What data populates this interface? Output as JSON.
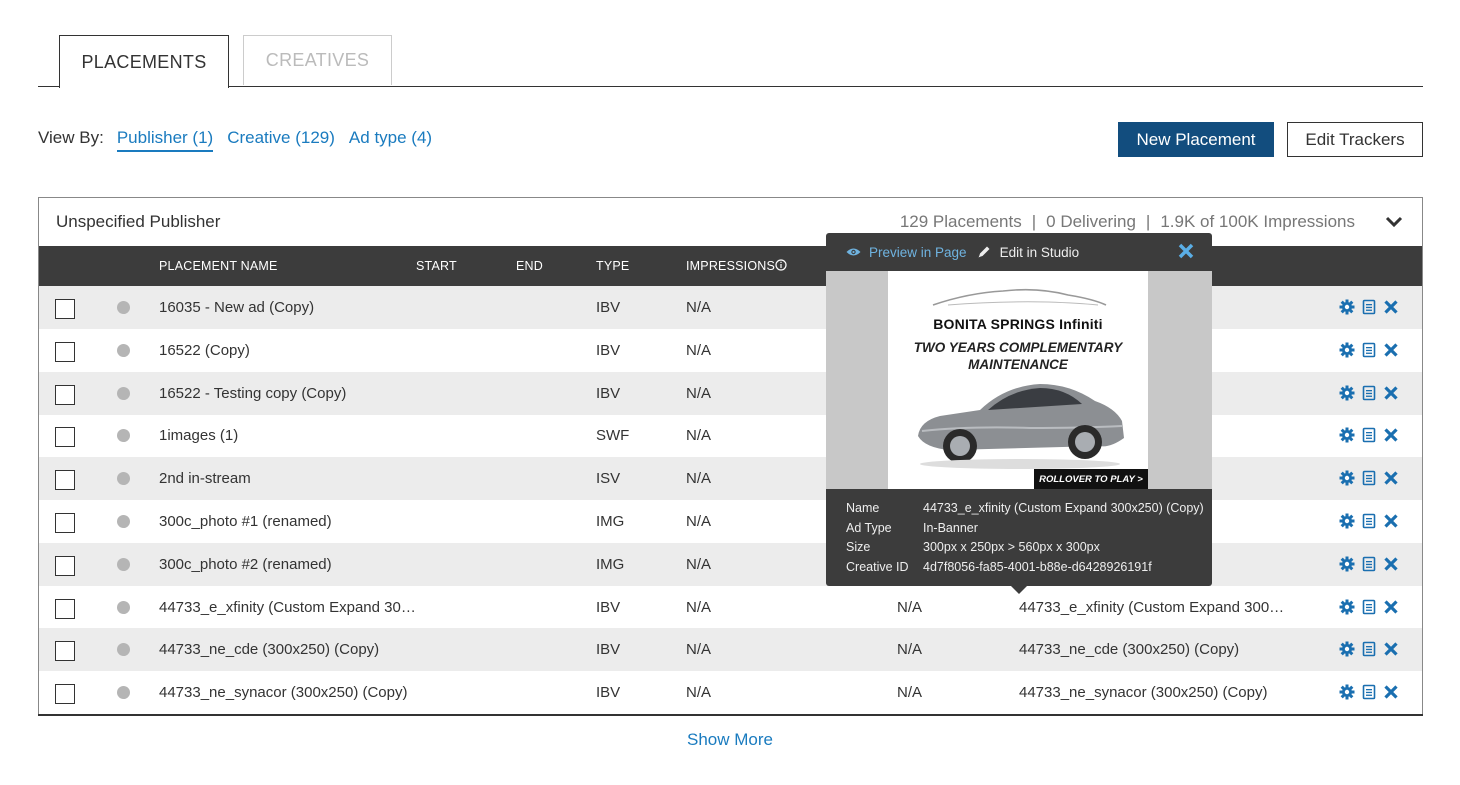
{
  "tabs": [
    {
      "label": "PLACEMENTS",
      "active": true
    },
    {
      "label": "CREATIVES",
      "active": false
    }
  ],
  "view_by": {
    "label": "View By:",
    "options": [
      {
        "label": "Publisher (1)",
        "active": true
      },
      {
        "label": "Creative (129)",
        "active": false
      },
      {
        "label": "Ad type (4)",
        "active": false
      }
    ]
  },
  "buttons": {
    "new_placement": "New Placement",
    "edit_trackers": "Edit Trackers"
  },
  "panel": {
    "title": "Unspecified Publisher",
    "stats": {
      "placements": "129 Placements",
      "delivering": "0 Delivering",
      "impressions": "1.9K of 100K Impressions",
      "separator": "|"
    }
  },
  "table": {
    "headers": {
      "name": "PLACEMENT NAME",
      "start": "START",
      "end": "END",
      "type": "TYPE",
      "impressions": "IMPRESSIONS"
    },
    "rows": [
      {
        "name": "16035 - New ad (Copy)",
        "type": "IBV",
        "impressions": "N/A",
        "col6": "",
        "creative": ""
      },
      {
        "name": "16522 (Copy)",
        "type": "IBV",
        "impressions": "N/A",
        "col6": "",
        "creative": ""
      },
      {
        "name": "16522 - Testing copy (Copy)",
        "type": "IBV",
        "impressions": "N/A",
        "col6": "",
        "creative": ""
      },
      {
        "name": "1images (1)",
        "type": "SWF",
        "impressions": "N/A",
        "col6": "",
        "creative": ""
      },
      {
        "name": "2nd in-stream",
        "type": "ISV",
        "impressions": "N/A",
        "col6": "",
        "creative": ""
      },
      {
        "name": "300c_photo #1 (renamed)",
        "type": "IMG",
        "impressions": "N/A",
        "col6": "",
        "creative": ""
      },
      {
        "name": "300c_photo #2 (renamed)",
        "type": "IMG",
        "impressions": "N/A",
        "col6": "",
        "creative": ""
      },
      {
        "name": "44733_e_xfinity (Custom Expand 30…",
        "type": "IBV",
        "impressions": "N/A",
        "col6": "N/A",
        "creative": "44733_e_xfinity (Custom Expand 300…"
      },
      {
        "name": "44733_ne_cde (300x250) (Copy)",
        "type": "IBV",
        "impressions": "N/A",
        "col6": "N/A",
        "creative": "44733_ne_cde (300x250) (Copy)"
      },
      {
        "name": "44733_ne_synacor (300x250) (Copy)",
        "type": "IBV",
        "impressions": "N/A",
        "col6": "N/A",
        "creative": "44733_ne_synacor (300x250) (Copy)"
      }
    ]
  },
  "show_more": "Show More",
  "popup": {
    "preview_link": "Preview in Page",
    "edit_link": "Edit in Studio",
    "ad": {
      "brand": "BONITA SPRINGS  Infiniti",
      "line1": "TWO YEARS COMPLEMENTARY",
      "line2": "MAINTENANCE",
      "cta": "ROLLOVER TO PLAY >"
    },
    "info": [
      {
        "key": "Name",
        "value": "44733_e_xfinity (Custom Expand 300x250) (Copy)"
      },
      {
        "key": "Ad Type",
        "value": "In-Banner"
      },
      {
        "key": "Size",
        "value": "300px x 250px > 560px x 300px"
      },
      {
        "key": "Creative ID",
        "value": "4d7f8056-fa85-4001-b88e-d6428926191f"
      }
    ]
  },
  "colors": {
    "accent": "#1a7bbf",
    "primary_button": "#124d7e",
    "header_bg": "#3c3c3c",
    "row_shade": "#ececec",
    "icon": "#1a6fb0"
  }
}
